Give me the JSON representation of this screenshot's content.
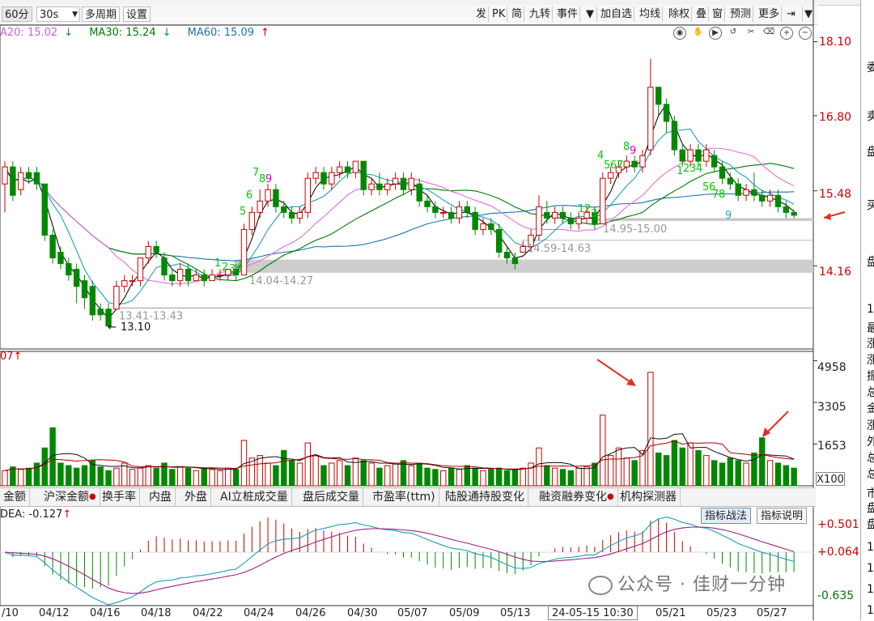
{
  "toolbar": {
    "left_buttons": [
      {
        "label": "60分",
        "selected": true
      },
      {
        "label": "30s",
        "selected": false,
        "dropdown": true
      },
      {
        "label": "多周期",
        "selected": false
      },
      {
        "label": "设置",
        "selected": false
      }
    ],
    "right_buttons": [
      "发",
      "PK",
      "简",
      "九转",
      "事件",
      "加自选",
      "均线",
      "除权",
      "叠",
      "窗",
      "预测",
      "更多"
    ]
  },
  "moving_averages": [
    {
      "label": "A20: 15.02",
      "arrow": "↓",
      "color": "#d060d0"
    },
    {
      "label": "MA30: 15.24",
      "arrow": "↓",
      "color": "#007a00"
    },
    {
      "label": "MA60: 15.09",
      "arrow": "↑",
      "color": "#1a73b0"
    }
  ],
  "price_axis": [
    "18.10",
    "16.80",
    "15.48",
    "14.16"
  ],
  "volume_axis": [
    "4958",
    "3305",
    "1653"
  ],
  "volume_label": "07",
  "volume_unit": "X100",
  "annotations": {
    "low_label": "13.10",
    "ranges": [
      "13.41-13.43",
      "14.04-14.27",
      "14.59-14.63",
      "14.95-15.00"
    ],
    "td_counts": [
      "1",
      "2",
      "3",
      "4",
      "5",
      "6",
      "7",
      "8",
      "9",
      "4",
      "5",
      "6",
      "7",
      "8",
      "9",
      "1",
      "2",
      "3",
      "1",
      "2",
      "3",
      "4",
      "5",
      "6",
      "7",
      "8",
      "9"
    ]
  },
  "indicator_tabs": [
    {
      "label": "金额",
      "dot": false
    },
    {
      "label": "沪深金额",
      "dot": true
    },
    {
      "label": "换手率",
      "dot": false
    },
    {
      "label": "内盘",
      "dot": false
    },
    {
      "label": "外盘",
      "dot": false
    },
    {
      "label": "AI立桩成交量",
      "dot": false
    },
    {
      "label": "盘后成交量",
      "dot": false
    },
    {
      "label": "市盈率(ttm)",
      "dot": false
    },
    {
      "label": "陆股通持股变化",
      "dot": false
    },
    {
      "label": "融资融券变化",
      "dot": true
    },
    {
      "label": "机构探测器",
      "dot": false
    }
  ],
  "macd": {
    "label": "DEA: -0.127",
    "arrow": "↑",
    "axis": [
      "+0.501",
      "+0.064",
      "-0.635"
    ],
    "buttons": [
      "指标战法",
      "指标说明"
    ]
  },
  "x_axis": [
    "/10",
    "04/12",
    "04/16",
    "04/18",
    "04/22",
    "04/24",
    "04/26",
    "04/30",
    "05/07",
    "05/09",
    "05/13",
    "05/21",
    "05/23",
    "05/27"
  ],
  "cursor_time": "24-05-15 10:30",
  "watermark": "公众号 · 佳财一分钟",
  "right_panel": [
    "委",
    "卖",
    "盘",
    "买",
    "盘",
    "14",
    "最",
    "涨",
    "涨",
    "振",
    "总",
    "金",
    "涨",
    "外",
    "总",
    "总",
    "市",
    "盘",
    "盘",
    "14",
    "14",
    "14",
    "14"
  ],
  "colors": {
    "up": "#cc0000",
    "down": "#008800",
    "ma5": "#111111",
    "ma10": "#1a9fc0",
    "ma20": "#e070e0",
    "ma30": "#007a00",
    "ma60": "#1a73b0"
  },
  "chart_data": {
    "type": "candlestick",
    "price_axis_ticks": [
      18.1,
      16.8,
      15.48,
      14.16
    ],
    "ylim": [
      12.7,
      18.25
    ],
    "candles": [
      {
        "x": 0,
        "o": 15.6,
        "c": 15.9,
        "h": 16.0,
        "l": 15.1
      },
      {
        "x": 1,
        "o": 15.9,
        "c": 15.4,
        "h": 16.0,
        "l": 15.3
      },
      {
        "x": 2,
        "o": 15.5,
        "c": 15.8,
        "h": 15.9,
        "l": 15.4
      },
      {
        "x": 3,
        "o": 15.8,
        "c": 15.7,
        "h": 15.9,
        "l": 15.6
      },
      {
        "x": 4,
        "o": 15.8,
        "c": 15.6,
        "h": 15.9,
        "l": 15.5
      },
      {
        "x": 5,
        "o": 15.6,
        "c": 14.7,
        "h": 15.6,
        "l": 14.6
      },
      {
        "x": 6,
        "o": 14.7,
        "c": 14.3,
        "h": 14.8,
        "l": 14.2
      },
      {
        "x": 7,
        "o": 14.4,
        "c": 14.2,
        "h": 14.5,
        "l": 14.1
      },
      {
        "x": 8,
        "o": 14.2,
        "c": 14.0,
        "h": 14.3,
        "l": 13.9
      },
      {
        "x": 9,
        "o": 14.1,
        "c": 13.8,
        "h": 14.2,
        "l": 13.5
      },
      {
        "x": 10,
        "o": 13.9,
        "c": 13.6,
        "h": 14.0,
        "l": 13.4
      },
      {
        "x": 11,
        "o": 13.8,
        "c": 13.3,
        "h": 13.9,
        "l": 13.2
      },
      {
        "x": 12,
        "o": 13.4,
        "c": 13.3,
        "h": 13.5,
        "l": 13.2
      },
      {
        "x": 13,
        "o": 13.4,
        "c": 13.1,
        "h": 13.5,
        "l": 13.1
      },
      {
        "x": 14,
        "o": 13.4,
        "c": 13.8,
        "h": 13.9,
        "l": 13.4
      },
      {
        "x": 15,
        "o": 13.8,
        "c": 13.9,
        "h": 14.0,
        "l": 13.7
      },
      {
        "x": 16,
        "o": 13.9,
        "c": 13.9,
        "h": 14.0,
        "l": 13.8
      },
      {
        "x": 17,
        "o": 13.9,
        "c": 14.3,
        "h": 14.3,
        "l": 13.8
      },
      {
        "x": 18,
        "o": 14.3,
        "c": 14.5,
        "h": 14.6,
        "l": 14.2
      },
      {
        "x": 19,
        "o": 14.5,
        "c": 14.4,
        "h": 14.6,
        "l": 14.3
      },
      {
        "x": 20,
        "o": 14.3,
        "c": 14.0,
        "h": 14.4,
        "l": 13.9
      },
      {
        "x": 21,
        "o": 14.0,
        "c": 13.9,
        "h": 14.1,
        "l": 13.8
      },
      {
        "x": 22,
        "o": 13.9,
        "c": 14.1,
        "h": 14.2,
        "l": 13.8
      },
      {
        "x": 23,
        "o": 14.1,
        "c": 13.9,
        "h": 14.2,
        "l": 13.8
      },
      {
        "x": 24,
        "o": 13.9,
        "c": 14.0,
        "h": 14.1,
        "l": 13.9
      },
      {
        "x": 25,
        "o": 14.0,
        "c": 13.9,
        "h": 14.1,
        "l": 13.8
      },
      {
        "x": 26,
        "o": 13.9,
        "c": 14.0,
        "h": 14.1,
        "l": 13.9
      },
      {
        "x": 27,
        "o": 14.0,
        "c": 14.0,
        "h": 14.1,
        "l": 13.9
      },
      {
        "x": 28,
        "o": 14.0,
        "c": 14.1,
        "h": 14.1,
        "l": 13.9
      },
      {
        "x": 29,
        "o": 14.1,
        "c": 14.0,
        "h": 14.2,
        "l": 13.9
      },
      {
        "x": 30,
        "o": 14.0,
        "c": 14.8,
        "h": 14.9,
        "l": 14.0
      },
      {
        "x": 31,
        "o": 14.8,
        "c": 15.1,
        "h": 15.2,
        "l": 14.7
      },
      {
        "x": 32,
        "o": 15.1,
        "c": 15.3,
        "h": 15.5,
        "l": 15.0
      },
      {
        "x": 33,
        "o": 15.3,
        "c": 15.5,
        "h": 15.6,
        "l": 15.2
      },
      {
        "x": 34,
        "o": 15.5,
        "c": 15.2,
        "h": 15.6,
        "l": 15.1
      },
      {
        "x": 35,
        "o": 15.2,
        "c": 15.1,
        "h": 15.3,
        "l": 15.0
      },
      {
        "x": 36,
        "o": 15.1,
        "c": 15.0,
        "h": 15.2,
        "l": 14.9
      },
      {
        "x": 37,
        "o": 15.0,
        "c": 15.1,
        "h": 15.2,
        "l": 14.9
      },
      {
        "x": 38,
        "o": 15.1,
        "c": 15.7,
        "h": 15.8,
        "l": 15.0
      },
      {
        "x": 39,
        "o": 15.7,
        "c": 15.8,
        "h": 15.9,
        "l": 15.6
      },
      {
        "x": 40,
        "o": 15.8,
        "c": 15.6,
        "h": 15.9,
        "l": 15.5
      },
      {
        "x": 41,
        "o": 15.6,
        "c": 15.8,
        "h": 15.9,
        "l": 15.5
      },
      {
        "x": 42,
        "o": 15.8,
        "c": 15.9,
        "h": 16.0,
        "l": 15.7
      },
      {
        "x": 43,
        "o": 15.9,
        "c": 15.8,
        "h": 16.0,
        "l": 15.7
      },
      {
        "x": 44,
        "o": 15.8,
        "c": 16.0,
        "h": 16.0,
        "l": 15.7
      },
      {
        "x": 45,
        "o": 16.0,
        "c": 15.5,
        "h": 16.0,
        "l": 15.4
      },
      {
        "x": 46,
        "o": 15.5,
        "c": 15.6,
        "h": 15.7,
        "l": 15.4
      },
      {
        "x": 47,
        "o": 15.6,
        "c": 15.5,
        "h": 15.8,
        "l": 15.4
      },
      {
        "x": 48,
        "o": 15.5,
        "c": 15.6,
        "h": 15.7,
        "l": 15.4
      },
      {
        "x": 49,
        "o": 15.6,
        "c": 15.7,
        "h": 15.8,
        "l": 15.5
      },
      {
        "x": 50,
        "o": 15.7,
        "c": 15.5,
        "h": 15.8,
        "l": 15.4
      },
      {
        "x": 51,
        "o": 15.5,
        "c": 15.7,
        "h": 15.8,
        "l": 15.4
      },
      {
        "x": 52,
        "o": 15.6,
        "c": 15.3,
        "h": 15.7,
        "l": 15.2
      },
      {
        "x": 53,
        "o": 15.3,
        "c": 15.2,
        "h": 15.4,
        "l": 15.1
      },
      {
        "x": 54,
        "o": 15.2,
        "c": 15.1,
        "h": 15.3,
        "l": 15.0
      },
      {
        "x": 55,
        "o": 15.1,
        "c": 15.1,
        "h": 15.2,
        "l": 15.0
      },
      {
        "x": 56,
        "o": 15.1,
        "c": 15.0,
        "h": 15.2,
        "l": 14.9
      },
      {
        "x": 57,
        "o": 15.0,
        "c": 15.2,
        "h": 15.3,
        "l": 14.9
      },
      {
        "x": 58,
        "o": 15.2,
        "c": 15.1,
        "h": 15.3,
        "l": 15.0
      },
      {
        "x": 59,
        "o": 15.1,
        "c": 14.8,
        "h": 15.2,
        "l": 14.7
      },
      {
        "x": 60,
        "o": 14.8,
        "c": 14.9,
        "h": 15.0,
        "l": 14.7
      },
      {
        "x": 61,
        "o": 14.9,
        "c": 14.8,
        "h": 15.0,
        "l": 14.7
      },
      {
        "x": 62,
        "o": 14.8,
        "c": 14.4,
        "h": 14.9,
        "l": 14.3
      },
      {
        "x": 63,
        "o": 14.4,
        "c": 14.3,
        "h": 14.5,
        "l": 14.2
      },
      {
        "x": 64,
        "o": 14.3,
        "c": 14.2,
        "h": 14.4,
        "l": 14.1
      },
      {
        "x": 65,
        "o": 14.4,
        "c": 14.5,
        "h": 14.6,
        "l": 14.4
      },
      {
        "x": 66,
        "o": 14.5,
        "c": 14.7,
        "h": 14.8,
        "l": 14.4
      },
      {
        "x": 67,
        "o": 14.7,
        "c": 15.2,
        "h": 15.4,
        "l": 14.6
      },
      {
        "x": 68,
        "o": 15.1,
        "c": 15.0,
        "h": 15.3,
        "l": 14.9
      },
      {
        "x": 69,
        "o": 15.0,
        "c": 15.1,
        "h": 15.2,
        "l": 14.9
      },
      {
        "x": 70,
        "o": 15.1,
        "c": 15.0,
        "h": 15.2,
        "l": 14.9
      },
      {
        "x": 71,
        "o": 15.0,
        "c": 14.9,
        "h": 15.1,
        "l": 14.8
      },
      {
        "x": 72,
        "o": 14.9,
        "c": 15.0,
        "h": 15.1,
        "l": 14.8
      },
      {
        "x": 73,
        "o": 15.0,
        "c": 15.1,
        "h": 15.2,
        "l": 14.9
      },
      {
        "x": 74,
        "o": 15.1,
        "c": 14.9,
        "h": 15.2,
        "l": 14.8
      },
      {
        "x": 75,
        "o": 14.9,
        "c": 15.7,
        "h": 15.8,
        "l": 14.9
      },
      {
        "x": 76,
        "o": 15.7,
        "c": 15.8,
        "h": 15.9,
        "l": 15.6
      },
      {
        "x": 77,
        "o": 15.8,
        "c": 15.9,
        "h": 16.0,
        "l": 15.7
      },
      {
        "x": 78,
        "o": 15.9,
        "c": 16.0,
        "h": 16.1,
        "l": 15.8
      },
      {
        "x": 79,
        "o": 16.0,
        "c": 15.9,
        "h": 16.1,
        "l": 15.8
      },
      {
        "x": 80,
        "o": 15.9,
        "c": 16.1,
        "h": 16.2,
        "l": 15.8
      },
      {
        "x": 81,
        "o": 16.2,
        "c": 17.3,
        "h": 17.8,
        "l": 16.1
      },
      {
        "x": 82,
        "o": 17.3,
        "c": 17.0,
        "h": 17.3,
        "l": 16.8
      },
      {
        "x": 83,
        "o": 17.0,
        "c": 16.7,
        "h": 17.1,
        "l": 16.5
      },
      {
        "x": 84,
        "o": 16.7,
        "c": 16.2,
        "h": 16.8,
        "l": 16.1
      },
      {
        "x": 85,
        "o": 16.2,
        "c": 16.0,
        "h": 16.3,
        "l": 15.9
      },
      {
        "x": 86,
        "o": 16.0,
        "c": 16.2,
        "h": 16.3,
        "l": 15.9
      },
      {
        "x": 87,
        "o": 16.2,
        "c": 16.0,
        "h": 16.3,
        "l": 15.9
      },
      {
        "x": 88,
        "o": 16.0,
        "c": 16.2,
        "h": 16.3,
        "l": 15.9
      },
      {
        "x": 89,
        "o": 16.1,
        "c": 15.9,
        "h": 16.2,
        "l": 15.8
      },
      {
        "x": 90,
        "o": 15.9,
        "c": 15.7,
        "h": 16.0,
        "l": 15.6
      },
      {
        "x": 91,
        "o": 15.7,
        "c": 15.6,
        "h": 15.8,
        "l": 15.5
      },
      {
        "x": 92,
        "o": 15.6,
        "c": 15.4,
        "h": 15.7,
        "l": 15.3
      },
      {
        "x": 93,
        "o": 15.4,
        "c": 15.5,
        "h": 15.6,
        "l": 15.3
      },
      {
        "x": 94,
        "o": 15.5,
        "c": 15.4,
        "h": 15.8,
        "l": 15.3
      },
      {
        "x": 95,
        "o": 15.4,
        "c": 15.3,
        "h": 15.5,
        "l": 15.2
      },
      {
        "x": 96,
        "o": 15.3,
        "c": 15.4,
        "h": 15.5,
        "l": 15.2
      },
      {
        "x": 97,
        "o": 15.4,
        "c": 15.2,
        "h": 15.5,
        "l": 15.1
      },
      {
        "x": 98,
        "o": 15.2,
        "c": 15.1,
        "h": 15.3,
        "l": 15.0
      },
      {
        "x": 99,
        "o": 15.1,
        "c": 15.05,
        "h": 15.15,
        "l": 15.0
      }
    ],
    "volume_axis_ticks": [
      4958,
      3305,
      1653
    ],
    "volume": [
      600,
      750,
      650,
      700,
      900,
      1500,
      2300,
      900,
      800,
      700,
      800,
      1000,
      750,
      600,
      700,
      900,
      650,
      700,
      800,
      700,
      900,
      650,
      750,
      700,
      600,
      700,
      650,
      600,
      700,
      650,
      1800,
      1100,
      1200,
      900,
      800,
      1400,
      1000,
      900,
      1700,
      1200,
      800,
      900,
      1000,
      800,
      1100,
      1000,
      900,
      700,
      800,
      900,
      1000,
      800,
      900,
      700,
      650,
      600,
      700,
      650,
      800,
      700,
      600,
      650,
      700,
      600,
      650,
      700,
      900,
      1500,
      800,
      700,
      650,
      600,
      700,
      750,
      900,
      2800,
      1200,
      1500,
      1100,
      1000,
      1400,
      4500,
      1300,
      1200,
      1800,
      1500,
      1700,
      1400,
      1200,
      1000,
      900,
      1100,
      1000,
      900,
      1300,
      1900,
      1000,
      900,
      800,
      700
    ],
    "macd_axis_ticks": [
      0.501,
      0.064,
      -0.635
    ]
  }
}
